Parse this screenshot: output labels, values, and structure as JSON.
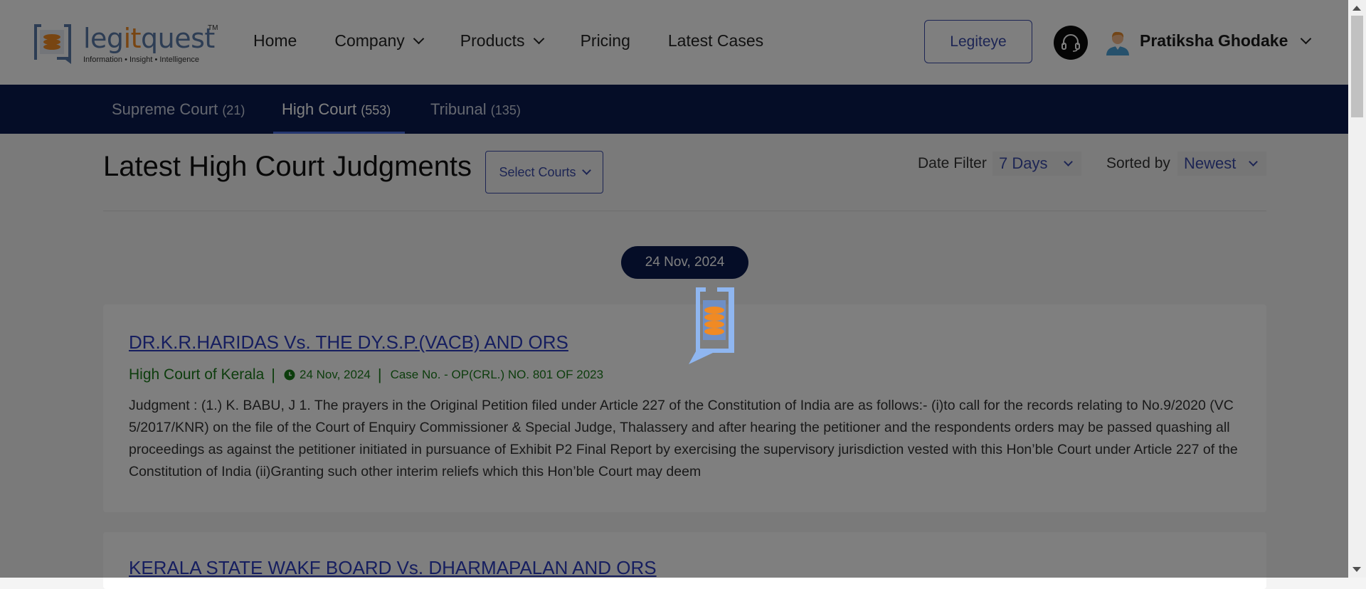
{
  "brand": {
    "logo_name_pre": "leg",
    "logo_name_it": "it",
    "logo_name_post": "quest",
    "logo_tm": "TM",
    "tagline": "Information • Insight • Intelligence"
  },
  "nav": [
    {
      "label": "Home",
      "has_dropdown": false
    },
    {
      "label": "Company",
      "has_dropdown": true
    },
    {
      "label": "Products",
      "has_dropdown": true
    },
    {
      "label": "Pricing",
      "has_dropdown": false
    },
    {
      "label": "Latest Cases",
      "has_dropdown": false
    }
  ],
  "header": {
    "legiteye_label": "Legiteye",
    "support_icon": "headset-icon",
    "user_name": "Pratiksha Ghodake"
  },
  "tabs": [
    {
      "label": "Supreme Court",
      "count": "(21)",
      "active": false
    },
    {
      "label": "High Court",
      "count": "(553)",
      "active": true
    },
    {
      "label": "Tribunal",
      "count": "(135)",
      "active": false
    }
  ],
  "toolbar": {
    "title": "Latest High Court Judgments",
    "select_courts": "Select Courts",
    "date_filter_label": "Date Filter",
    "date_filter_value": "7 Days",
    "sorted_by_label": "Sorted by",
    "sorted_by_value": "Newest"
  },
  "date_group": "24 Nov, 2024",
  "cases": [
    {
      "title": "DR.K.R.HARIDAS Vs. THE DY.S.P.(VACB) AND ORS",
      "court": "High Court of Kerala",
      "date": "24 Nov, 2024",
      "case_no": "Case No. - OP(CRL.) NO. 801 OF 2023",
      "snippet": "Judgment : (1.) K. BABU, J 1. The prayers in the Original Petition filed under Article 227 of the Constitution of India are as follows:- (i)to call for the records relating to No.9/2020 (VC 5/2017/KNR) on the file of the Court of Enquiry Commissioner & Special Judge, Thalassery and after hearing the petitioner and the respondents orders may be passed quashing all proceedings as against the petitioner initiated in pursuance of Exhibit P2 Final Report by exercising the supervisory jurisdiction vested with this Hon’ble Court under Article 227 of the Constitution of India (ii)Granting such other interim reliefs which this Hon’ble Court may deem"
    },
    {
      "title": "KERALA STATE WAKF BOARD Vs. DHARMAPALAN AND ORS"
    }
  ],
  "colors": {
    "brand_blue": "#5b7aa8",
    "brand_orange": "#f08a24",
    "navy": "#0a1b4f",
    "link_blue": "#2d3dbf",
    "court_green": "#1a7a1a",
    "overlay": "rgba(0,0,0,0.5)"
  }
}
